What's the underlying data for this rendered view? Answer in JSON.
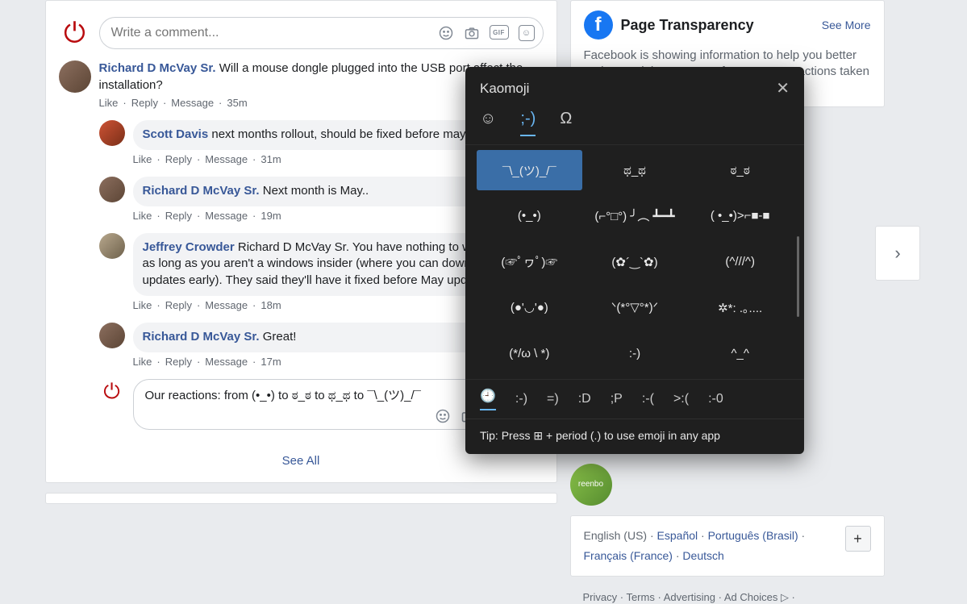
{
  "compose": {
    "placeholder": "Write a comment..."
  },
  "comments": [
    {
      "author": "Richard D McVay Sr.",
      "text": "Will a mouse dongle plugged into the USB port affect the installation?",
      "time": "35m"
    }
  ],
  "replies": [
    {
      "author": "Scott Davis",
      "text": "next months rollout, should be fixed before mays updates.",
      "time": "31m"
    },
    {
      "author": "Richard D McVay Sr.",
      "text": "Next month is May..",
      "time": "19m"
    },
    {
      "author": "Jeffrey Crowder",
      "text": "Richard D McVay Sr. You have nothing to worry about, as long as you aren't a windows insider (where you can download updates early). They said they'll have it fixed before May updates roll out.",
      "time": "18m"
    },
    {
      "author": "Richard D McVay Sr.",
      "text": "Great!",
      "time": "17m"
    }
  ],
  "meta": {
    "like": "Like",
    "reply": "Reply",
    "message": "Message"
  },
  "our_reactions": "Our reactions: from (•_•) to ಠ_ಠ to ಥ_ಥ to ¯\\_(ツ)_/¯",
  "see_all": "See All",
  "page_transparency": {
    "title": "Page Transparency",
    "see_more": "See More",
    "body": "Facebook is showing information to help you better understand the purpose of a Page. See actions taken by"
  },
  "lang": {
    "current": "English (US)",
    "others": [
      "Español",
      "Português (Brasil)",
      "Français (France)",
      "Deutsch"
    ]
  },
  "footer": [
    "Privacy",
    "Terms",
    "Advertising",
    "Ad Choices"
  ],
  "gif_label": "GIF",
  "kaomoji": {
    "title": "Kaomoji",
    "grid": [
      "¯\\_(ツ)_/¯",
      "ಥ_ಥ",
      "ಠ_ಠ",
      "(•_•)",
      "(⌐°□°) ╯︵ ┻━┻",
      "( •_•)>⌐■-■",
      "(☞ﾟヮﾟ)☞",
      "(✿´‿`✿)",
      "(^///^)",
      "(●'◡'●)",
      "ᐠ(*°▽°*)ᐟ",
      "✲*: .｡....",
      "(*/ω \\ *)",
      ":-)",
      "^_^"
    ],
    "recents": [
      ":-)",
      "=)",
      ":D",
      ";P",
      ":-(",
      ">:(",
      ":-0"
    ],
    "tip_prefix": "Tip: Press ",
    "tip_suffix": " + period (.) to use emoji in any app"
  }
}
